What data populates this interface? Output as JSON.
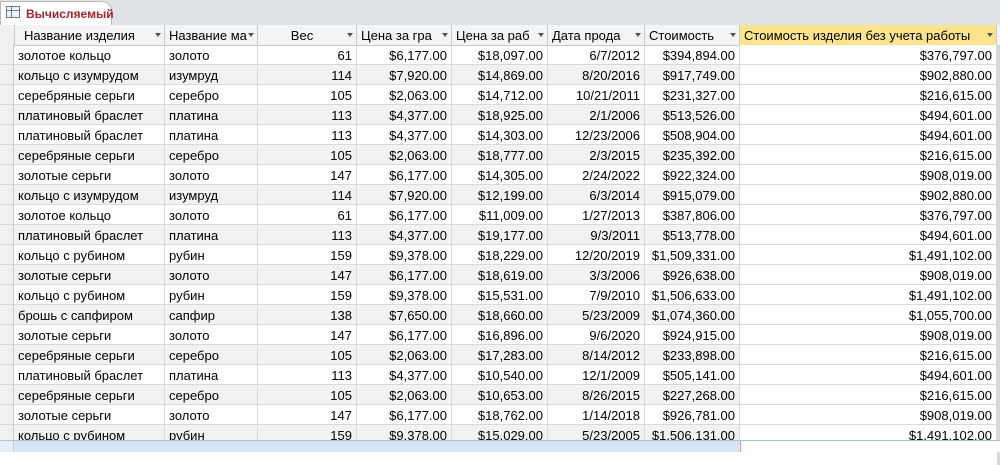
{
  "tab": {
    "label": "Вычисляемый",
    "icon": "table-icon"
  },
  "columns": [
    "Название изделия",
    "Название ма",
    "Вес",
    "Цена за гра",
    "Цена за раб",
    "Дата прода",
    "Стоимость",
    "Стоимость изделия без учета работы"
  ],
  "rows": [
    [
      "золотое кольцо",
      "золото",
      "61",
      "$6,177.00",
      "$18,097.00",
      "6/7/2012",
      "$394,894.00",
      "$376,797.00"
    ],
    [
      "кольцо с изумрудом",
      "изумруд",
      "114",
      "$7,920.00",
      "$14,869.00",
      "8/20/2016",
      "$917,749.00",
      "$902,880.00"
    ],
    [
      "серебряные серьги",
      "серебро",
      "105",
      "$2,063.00",
      "$14,712.00",
      "10/21/2011",
      "$231,327.00",
      "$216,615.00"
    ],
    [
      "платиновый браслет",
      "платина",
      "113",
      "$4,377.00",
      "$18,925.00",
      "2/1/2006",
      "$513,526.00",
      "$494,601.00"
    ],
    [
      "платиновый браслет",
      "платина",
      "113",
      "$4,377.00",
      "$14,303.00",
      "12/23/2006",
      "$508,904.00",
      "$494,601.00"
    ],
    [
      "серебряные серьги",
      "серебро",
      "105",
      "$2,063.00",
      "$18,777.00",
      "2/3/2015",
      "$235,392.00",
      "$216,615.00"
    ],
    [
      "золотые серьги",
      "золото",
      "147",
      "$6,177.00",
      "$14,305.00",
      "2/24/2022",
      "$922,324.00",
      "$908,019.00"
    ],
    [
      "кольцо с изумрудом",
      "изумруд",
      "114",
      "$7,920.00",
      "$12,199.00",
      "6/3/2014",
      "$915,079.00",
      "$902,880.00"
    ],
    [
      "золотое кольцо",
      "золото",
      "61",
      "$6,177.00",
      "$11,009.00",
      "1/27/2013",
      "$387,806.00",
      "$376,797.00"
    ],
    [
      "платиновый браслет",
      "платина",
      "113",
      "$4,377.00",
      "$19,177.00",
      "9/3/2011",
      "$513,778.00",
      "$494,601.00"
    ],
    [
      "кольцо с рубином",
      "рубин",
      "159",
      "$9,378.00",
      "$18,229.00",
      "12/20/2019",
      "$1,509,331.00",
      "$1,491,102.00"
    ],
    [
      "золотые серьги",
      "золото",
      "147",
      "$6,177.00",
      "$18,619.00",
      "3/3/2006",
      "$926,638.00",
      "$908,019.00"
    ],
    [
      "кольцо с рубином",
      "рубин",
      "159",
      "$9,378.00",
      "$15,531.00",
      "7/9/2010",
      "$1,506,633.00",
      "$1,491,102.00"
    ],
    [
      "брошь с сапфиром",
      "сапфир",
      "138",
      "$7,650.00",
      "$18,660.00",
      "5/23/2009",
      "$1,074,360.00",
      "$1,055,700.00"
    ],
    [
      "золотые серьги",
      "золото",
      "147",
      "$6,177.00",
      "$16,896.00",
      "9/6/2020",
      "$924,915.00",
      "$908,019.00"
    ],
    [
      "серебряные серьги",
      "серебро",
      "105",
      "$2,063.00",
      "$17,283.00",
      "8/14/2012",
      "$233,898.00",
      "$216,615.00"
    ],
    [
      "платиновый браслет",
      "платина",
      "113",
      "$4,377.00",
      "$10,540.00",
      "12/1/2009",
      "$505,141.00",
      "$494,601.00"
    ],
    [
      "серебряные серьги",
      "серебро",
      "105",
      "$2,063.00",
      "$10,653.00",
      "8/26/2015",
      "$227,268.00",
      "$216,615.00"
    ],
    [
      "золотые серьги",
      "золото",
      "147",
      "$6,177.00",
      "$18,762.00",
      "1/14/2018",
      "$926,781.00",
      "$908,019.00"
    ],
    [
      "кольцо с рубином",
      "рубин",
      "159",
      "$9,378.00",
      "$15,029.00",
      "5/23/2005",
      "$1,506,131.00",
      "$1,491,102.00"
    ]
  ]
}
